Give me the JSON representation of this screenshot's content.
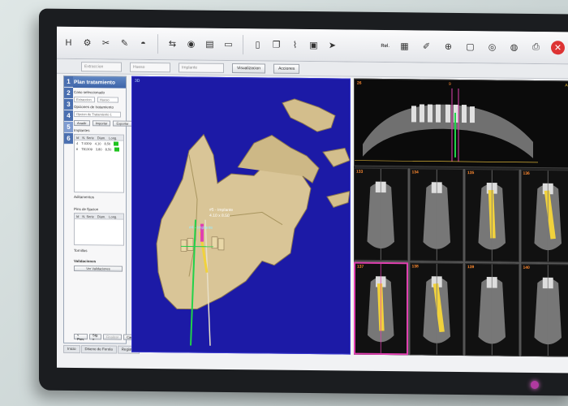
{
  "toolbar": {
    "left_icons": [
      "h-tool-icon",
      "gear-icon",
      "scissors-icon",
      "pencil-icon",
      "dome-icon",
      "arrows-icon",
      "globe-icon",
      "document-icon",
      "monitor-icon",
      "file-icon",
      "copy-icon",
      "tube-icon",
      "cube-icon",
      "cursor-icon"
    ],
    "right_label": "Rel.",
    "right_icons": [
      "layers-icon",
      "brush-icon",
      "zoom-icon",
      "panel-icon",
      "scan-icon",
      "disc-icon",
      "printer-icon",
      "close-icon"
    ]
  },
  "subbar": {
    "combo1": "Extraccion",
    "combo2": "Hueso",
    "combo3": "Implante",
    "btn_visualizacion": "Visualizacion",
    "btn_acciones": "Acciones"
  },
  "panel": {
    "title": "Plan tratamiento",
    "steps": [
      "1",
      "2",
      "3",
      "4",
      "5",
      "6"
    ],
    "active_step": "5",
    "label_case": "Caso seleccionado",
    "combo_case_a": "Extraccion",
    "combo_case_b": "Hueso",
    "label_options": "Opciones de tratamiento",
    "combo_option": "Opcion de Tratamiento 1",
    "btn_anadir": "Anadir",
    "btn_importar": "Importar",
    "btn_exportar": "Exportar",
    "label_implants": "Implantes",
    "grid_headers": [
      "Id",
      "N. Serie",
      "Diam.",
      "Long."
    ],
    "grid_rows": [
      {
        "id": "4",
        "serie": "T-0309",
        "diam": "4,10",
        "long": "8,50"
      },
      {
        "id": "6",
        "serie": "T81309",
        "diam": "3,80",
        "long": "8,50"
      }
    ],
    "label_abutments": "Aditamentos",
    "label_fixation": "Pins de fijacion",
    "fix_headers": [
      "Id",
      "N. Serie",
      "Diam.",
      "Long."
    ],
    "label_screws": "Tornillos",
    "label_validations": "Validaciones",
    "btn_validations": "Ver Validaciones",
    "btn_prev": "< Prev.",
    "btn_next": "Sig. >",
    "btn_finish": "Finalizar",
    "btn_cancel": "Cancelar"
  },
  "bottom_tabs": [
    "Inicio",
    "Diseno de Ferula",
    "Registro"
  ],
  "view3d": {
    "corner": "3D",
    "annot1": "#5 - Implante",
    "annot2": "4.10 x 8.50",
    "annot3": "#4 - Implante"
  },
  "pano": {
    "corner_left": "26",
    "corner_right": "AP",
    "mark_center": "9"
  },
  "slices": [
    {
      "num": "133",
      "highlight": false
    },
    {
      "num": "134",
      "highlight": false
    },
    {
      "num": "135",
      "highlight": false
    },
    {
      "num": "136",
      "highlight": false
    },
    {
      "num": "137",
      "highlight": true
    },
    {
      "num": "138",
      "highlight": false
    },
    {
      "num": "139",
      "highlight": false
    },
    {
      "num": "140",
      "highlight": false
    }
  ],
  "colors": {
    "view3d_bg": "#1c1aa6",
    "bone": "#d9c597",
    "implant_yellow": "#f1d23c",
    "axis_green": "#22d24a",
    "accent_magenta": "#e040b0"
  }
}
